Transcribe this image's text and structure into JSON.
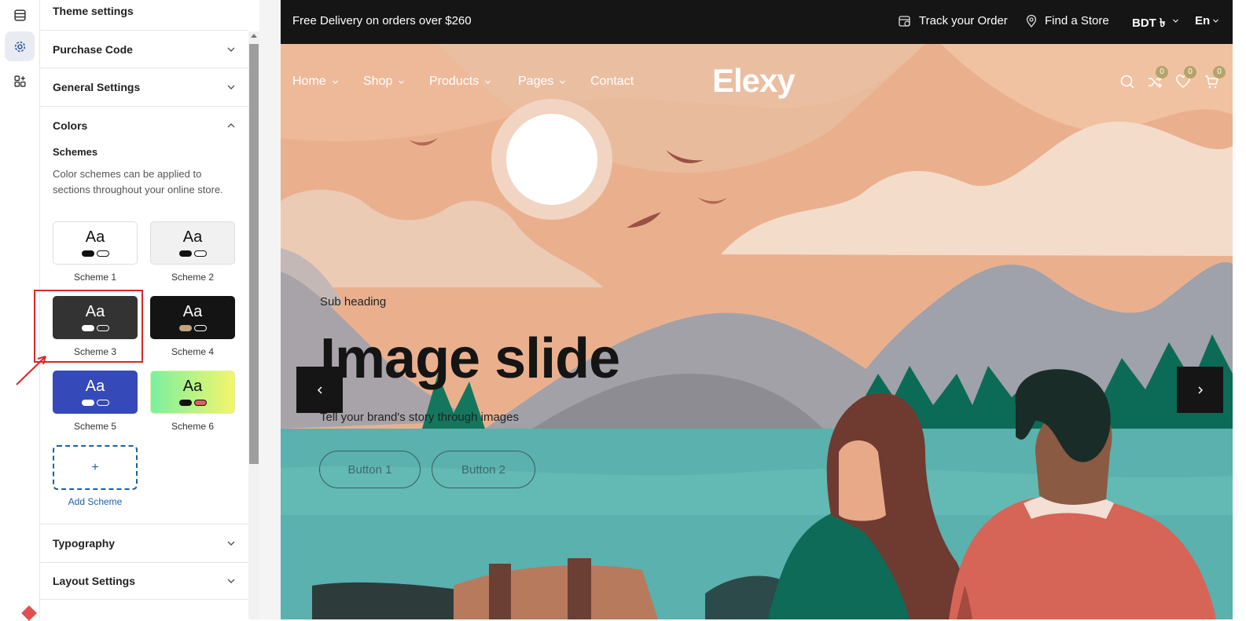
{
  "rail": {
    "icons": [
      "layout-icon",
      "gear-icon",
      "apps-icon"
    ]
  },
  "panel": {
    "title": "Theme settings",
    "sections": {
      "purchase_code": "Purchase Code",
      "general_settings": "General Settings",
      "colors": "Colors",
      "typography": "Typography",
      "layout_settings": "Layout Settings"
    },
    "schemes_heading": "Schemes",
    "schemes_description": "Color schemes can be applied to sections throughout your online store.",
    "schemes": [
      {
        "name": "Scheme 1",
        "sample": "Aa",
        "bg": "#ffffff",
        "text": "#111111",
        "pill1": "#111111",
        "pill2": "#ffffff"
      },
      {
        "name": "Scheme 2",
        "sample": "Aa",
        "bg": "#f1f1f1",
        "text": "#111111",
        "pill1": "#111111",
        "pill2": "#ffffff"
      },
      {
        "name": "Scheme 3",
        "sample": "Aa",
        "bg": "#333333",
        "text": "#ffffff",
        "pill1": "#ffffff",
        "pill2": "#333333"
      },
      {
        "name": "Scheme 4",
        "sample": "Aa",
        "bg": "#141414",
        "text": "#ffffff",
        "pill1": "#c4a47c",
        "pill2": "#141414"
      },
      {
        "name": "Scheme 5",
        "sample": "Aa",
        "bg": "#3549b8",
        "text": "#ffffff",
        "pill1": "#ffffff",
        "pill2": "#3549b8"
      },
      {
        "name": "Scheme 6",
        "sample": "Aa",
        "bg": "gradient",
        "text": "#111111",
        "pill1": "#111111",
        "pill2": "#d9645b"
      }
    ],
    "add_scheme_symbol": "+",
    "add_scheme_label": "Add Scheme",
    "highlight_color": "#d62828"
  },
  "store": {
    "announcement": "Free Delivery on orders over $260",
    "track_order": "Track your Order",
    "find_store": "Find a Store",
    "currency": "BDT ৳",
    "language": "En",
    "nav": [
      "Home",
      "Shop",
      "Products",
      "Pages",
      "Contact"
    ],
    "logo": "Elexy",
    "badges": {
      "compare": "0",
      "wishlist": "0",
      "cart": "0"
    },
    "hero": {
      "sub_heading": "Sub heading",
      "heading": "Image slide",
      "text": "Tell your brand's story through images",
      "button1": "Button 1",
      "button2": "Button 2"
    }
  }
}
